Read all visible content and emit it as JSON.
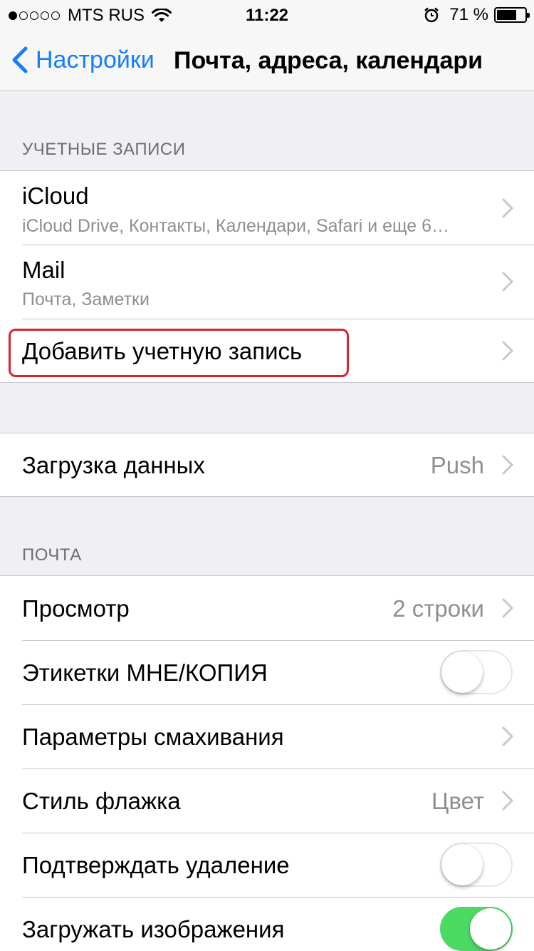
{
  "status_bar": {
    "carrier": "MTS RUS",
    "time": "11:22",
    "battery_percent": "71 %",
    "battery_level": 0.71,
    "icons": [
      "signal-dots-icon",
      "wifi-icon",
      "alarm-icon",
      "battery-icon"
    ]
  },
  "nav": {
    "back_label": "Настройки",
    "title": "Почта, адреса, календари"
  },
  "accounts": {
    "header": "УЧЕТНЫЕ ЗАПИСИ",
    "items": [
      {
        "title": "iCloud",
        "subtitle": "iCloud Drive, Контакты, Календари, Safari и еще 6…"
      },
      {
        "title": "Mail",
        "subtitle": "Почта, Заметки"
      },
      {
        "title": "Добавить учетную запись"
      }
    ]
  },
  "fetch": {
    "title": "Загрузка данных",
    "value": "Push"
  },
  "mail": {
    "header": "ПОЧТА",
    "items": [
      {
        "title": "Просмотр",
        "value": "2 строки"
      },
      {
        "title": "Этикетки МНЕ/КОПИЯ",
        "toggle": false
      },
      {
        "title": "Параметры смахивания"
      },
      {
        "title": "Стиль флажка",
        "value": "Цвет"
      },
      {
        "title": "Подтверждать удаление",
        "toggle": false
      },
      {
        "title": "Загружать изображения",
        "toggle": true
      }
    ]
  },
  "colors": {
    "accent": "#157efb",
    "toggle_on": "#4cd964",
    "highlight": "#d9232e",
    "background": "#efeff4"
  }
}
